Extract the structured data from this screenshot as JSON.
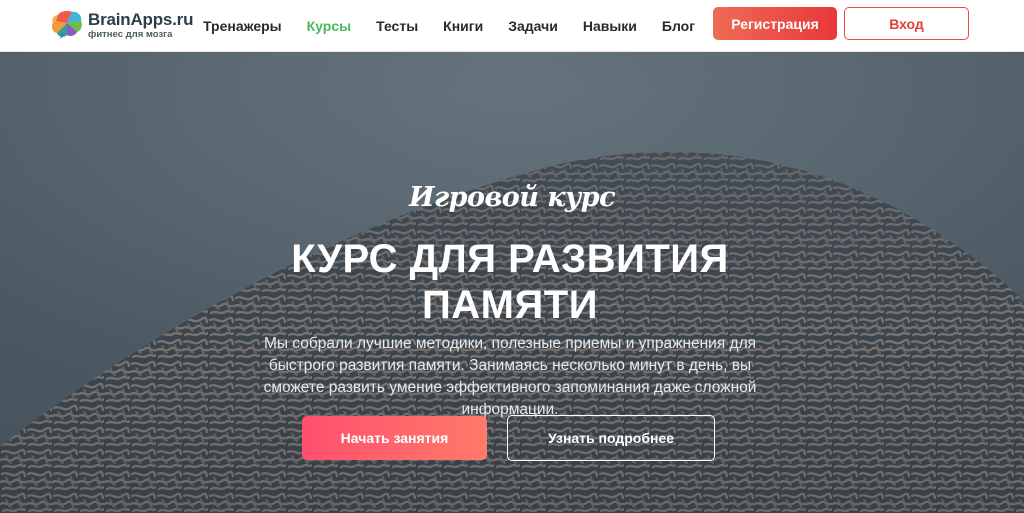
{
  "header": {
    "logo": {
      "name": "BrainApps.ru",
      "tagline": "фитнес для мозга"
    },
    "nav": [
      {
        "label": "Тренажеры",
        "active": false
      },
      {
        "label": "Курсы",
        "active": true
      },
      {
        "label": "Тесты",
        "active": false
      },
      {
        "label": "Книги",
        "active": false
      },
      {
        "label": "Задачи",
        "active": false
      },
      {
        "label": "Навыки",
        "active": false
      },
      {
        "label": "Блог",
        "active": false
      }
    ],
    "register_label": "Регистрация",
    "login_label": "Вход"
  },
  "hero": {
    "subtitle": "Игровой курс",
    "title": "КУРС ДЛЯ РАЗВИТИЯ ПАМЯТИ",
    "description": "Мы собрали лучшие методики, полезные приемы и упражнения для быстрого развития памяти. Занимаясь несколько минут в день, вы сможете развить умение эффективного запоминания даже сложной информации.",
    "start_label": "Начать занятия",
    "more_label": "Узнать подробнее",
    "background": "brain-coral-image"
  },
  "colors": {
    "accent_green": "#4cb85c",
    "accent_red": "#e8373b",
    "start_gradient": [
      "#ff4f6d",
      "#ff7a6a"
    ]
  }
}
